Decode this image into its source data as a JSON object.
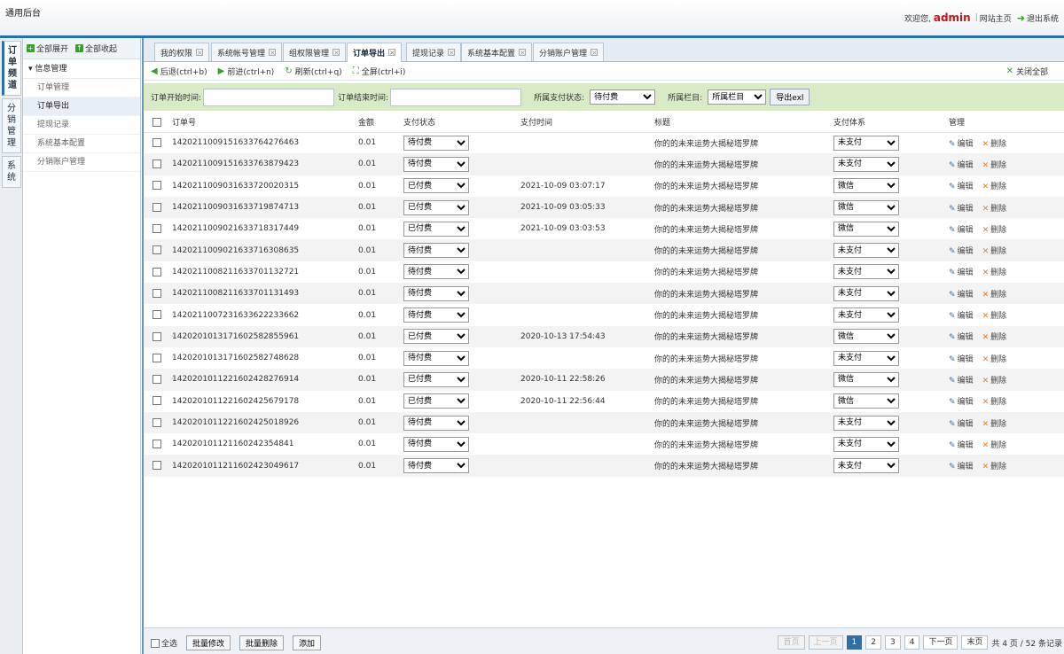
{
  "app": {
    "title": "通用后台"
  },
  "header": {
    "welcome": "欢迎您,",
    "user": "admin",
    "site_home": "网站主页",
    "logout": "退出系统"
  },
  "vtabs": [
    [
      "订",
      "单",
      "频",
      "道"
    ],
    [
      "分",
      "销",
      "管",
      "理"
    ],
    [
      "系",
      "统"
    ]
  ],
  "sidebar": {
    "expand_all": "全部展开",
    "collapse_all": "全部收起",
    "group": "信息管理",
    "items": [
      "订单管理",
      "订单导出",
      "提现记录",
      "系统基本配置",
      "分销账户管理"
    ]
  },
  "tabs": [
    "我的权限",
    "系统帐号管理",
    "组权限管理",
    "订单导出",
    "提现记录",
    "系统基本配置",
    "分销账户管理"
  ],
  "toolbar": {
    "back": "后退(ctrl+b)",
    "forward": "前进(ctrl+n)",
    "refresh": "刷新(ctrl+q)",
    "fullscreen": "全屏(ctrl+i)",
    "close_all": "关闭全部"
  },
  "filter": {
    "start_label": "订单开始时间:",
    "end_label": "订单结束时间:",
    "pay_status_label": "所属支付状态:",
    "pay_status_value": "待付费",
    "column_label": "所属栏目:",
    "column_value": "所属栏目",
    "export": "导出exl"
  },
  "table": {
    "headers": [
      "订单号",
      "金额",
      "支付状态",
      "支付时间",
      "标题",
      "支付体系",
      "管理"
    ],
    "edit": "编辑",
    "delete": "删除",
    "rows": [
      {
        "id": "1420211009151633764276463",
        "amount": "0.01",
        "status": "待付费",
        "time": "",
        "title": "你的的未来运势大揭秘塔罗牌",
        "system": "未支付"
      },
      {
        "id": "1420211009151633763879423",
        "amount": "0.01",
        "status": "待付费",
        "time": "",
        "title": "你的的未来运势大揭秘塔罗牌",
        "system": "未支付"
      },
      {
        "id": "1420211009031633720020315",
        "amount": "0.01",
        "status": "已付费",
        "time": "2021-10-09 03:07:17",
        "title": "你的的未来运势大揭秘塔罗牌",
        "system": "微信"
      },
      {
        "id": "1420211009031633719874713",
        "amount": "0.01",
        "status": "已付费",
        "time": "2021-10-09 03:05:33",
        "title": "你的的未来运势大揭秘塔罗牌",
        "system": "微信"
      },
      {
        "id": "1420211009021633718317449",
        "amount": "0.01",
        "status": "已付费",
        "time": "2021-10-09 03:03:53",
        "title": "你的的未来运势大揭秘塔罗牌",
        "system": "微信"
      },
      {
        "id": "1420211009021633716308635",
        "amount": "0.01",
        "status": "待付费",
        "time": "",
        "title": "你的的未来运势大揭秘塔罗牌",
        "system": "未支付"
      },
      {
        "id": "1420211008211633701132721",
        "amount": "0.01",
        "status": "待付费",
        "time": "",
        "title": "你的的未来运势大揭秘塔罗牌",
        "system": "未支付"
      },
      {
        "id": "1420211008211633701131493",
        "amount": "0.01",
        "status": "待付费",
        "time": "",
        "title": "你的的未来运势大揭秘塔罗牌",
        "system": "未支付"
      },
      {
        "id": "1420211007231633622233662",
        "amount": "0.01",
        "status": "待付费",
        "time": "",
        "title": "你的的未来运势大揭秘塔罗牌",
        "system": "未支付"
      },
      {
        "id": "1420201013171602582855961",
        "amount": "0.01",
        "status": "已付费",
        "time": "2020-10-13 17:54:43",
        "title": "你的的未来运势大揭秘塔罗牌",
        "system": "微信"
      },
      {
        "id": "1420201013171602582748628",
        "amount": "0.01",
        "status": "待付费",
        "time": "",
        "title": "你的的未来运势大揭秘塔罗牌",
        "system": "未支付"
      },
      {
        "id": "1420201011221602428276914",
        "amount": "0.01",
        "status": "已付费",
        "time": "2020-10-11 22:58:26",
        "title": "你的的未来运势大揭秘塔罗牌",
        "system": "微信"
      },
      {
        "id": "1420201011221602425679178",
        "amount": "0.01",
        "status": "已付费",
        "time": "2020-10-11 22:56:44",
        "title": "你的的未来运势大揭秘塔罗牌",
        "system": "微信"
      },
      {
        "id": "1420201011221602425018926",
        "amount": "0.01",
        "status": "待付费",
        "time": "",
        "title": "你的的未来运势大揭秘塔罗牌",
        "system": "未支付"
      },
      {
        "id": "142020101121160242354841",
        "amount": "0.01",
        "status": "待付费",
        "time": "",
        "title": "你的的未来运势大揭秘塔罗牌",
        "system": "未支付"
      },
      {
        "id": "1420201011211602423049617",
        "amount": "0.01",
        "status": "待付费",
        "time": "",
        "title": "你的的未来运势大揭秘塔罗牌",
        "system": "未支付"
      }
    ]
  },
  "footer": {
    "select_all": "全选",
    "batch_edit": "批量修改",
    "batch_delete": "批量删除",
    "add": "添加"
  },
  "pager": {
    "first": "首页",
    "prev": "上一页",
    "pages": [
      "1",
      "2",
      "3",
      "4"
    ],
    "current": "1",
    "next": "下一页",
    "last": "末页",
    "info": "共 4 页 / 52 条记录"
  },
  "colors": {
    "accent": "#2a6fa8",
    "filter_bg": "#d9ebc6",
    "admin": "#c0191b",
    "icon_green": "#3a9d2c"
  }
}
